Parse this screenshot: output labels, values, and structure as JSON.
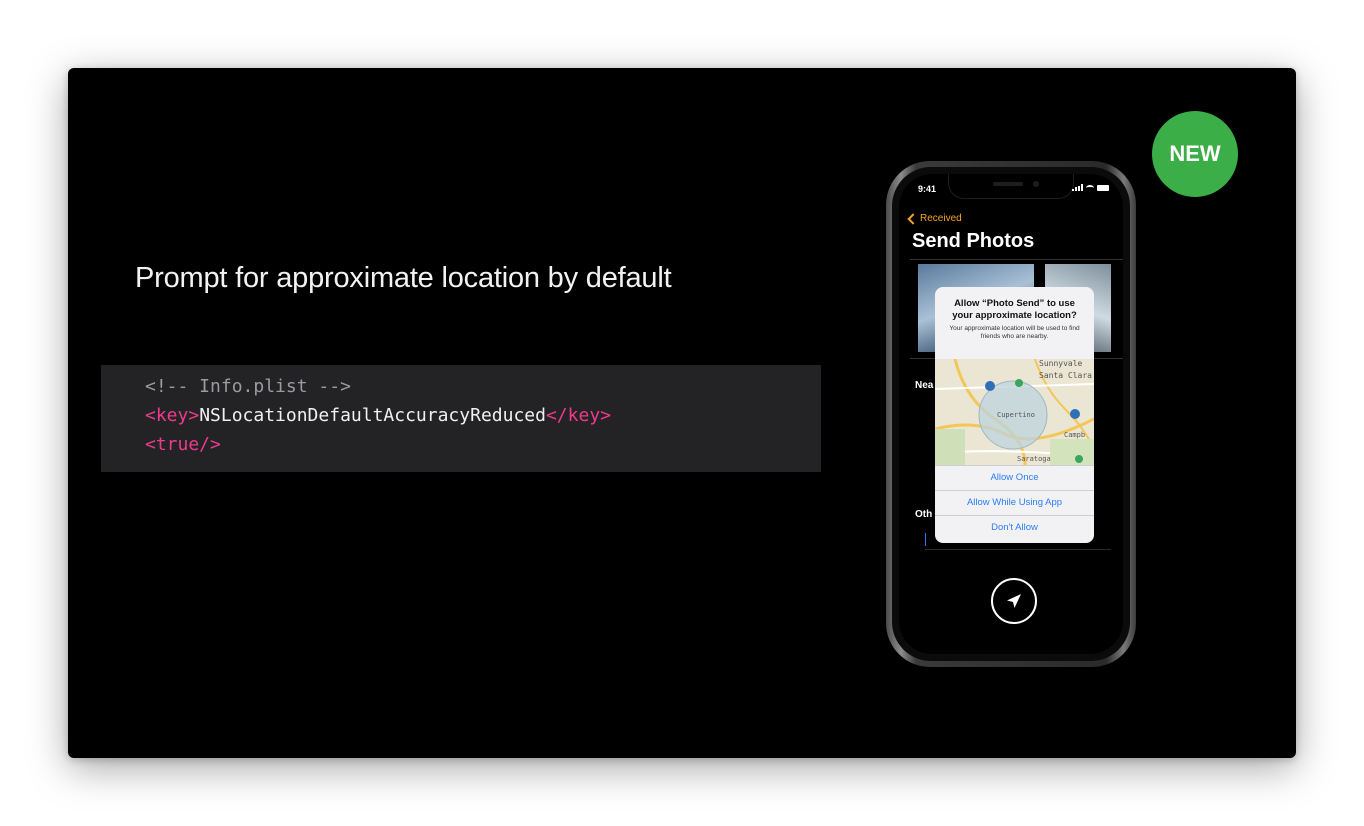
{
  "slide": {
    "title": "Prompt for approximate location by default",
    "badge": "NEW"
  },
  "code": {
    "comment": "<!-- Info.plist -->",
    "key_open": "<key>",
    "key_value": "NSLocationDefaultAccuracyReduced",
    "key_close": "</key>",
    "true_tag": "<true/>"
  },
  "phone": {
    "status_time": "9:41",
    "back_label": "Received",
    "app_title": "Send Photos",
    "section_nearby": "Nea",
    "section_other": "Oth",
    "alert": {
      "title": "Allow “Photo Send” to use your approximate location?",
      "message": "Your approximate location will be used to find friends who are nearby.",
      "map_labels": {
        "sunnyvale": "Sunnyvale",
        "santa_clara": "Santa Clara",
        "cupertino": "Cupertino",
        "campbell": "Campb",
        "saratoga": "Saratoga"
      },
      "buttons": [
        "Allow Once",
        "Allow While Using App",
        "Don't Allow"
      ]
    }
  },
  "colors": {
    "tag": "#ee3a8c",
    "comment": "#9a9aa0",
    "badge": "#3cae47",
    "accent": "#f4a623",
    "link": "#2a7cf6"
  },
  "icons": {
    "send": "paper-plane-icon",
    "back": "chevron-left-icon"
  }
}
